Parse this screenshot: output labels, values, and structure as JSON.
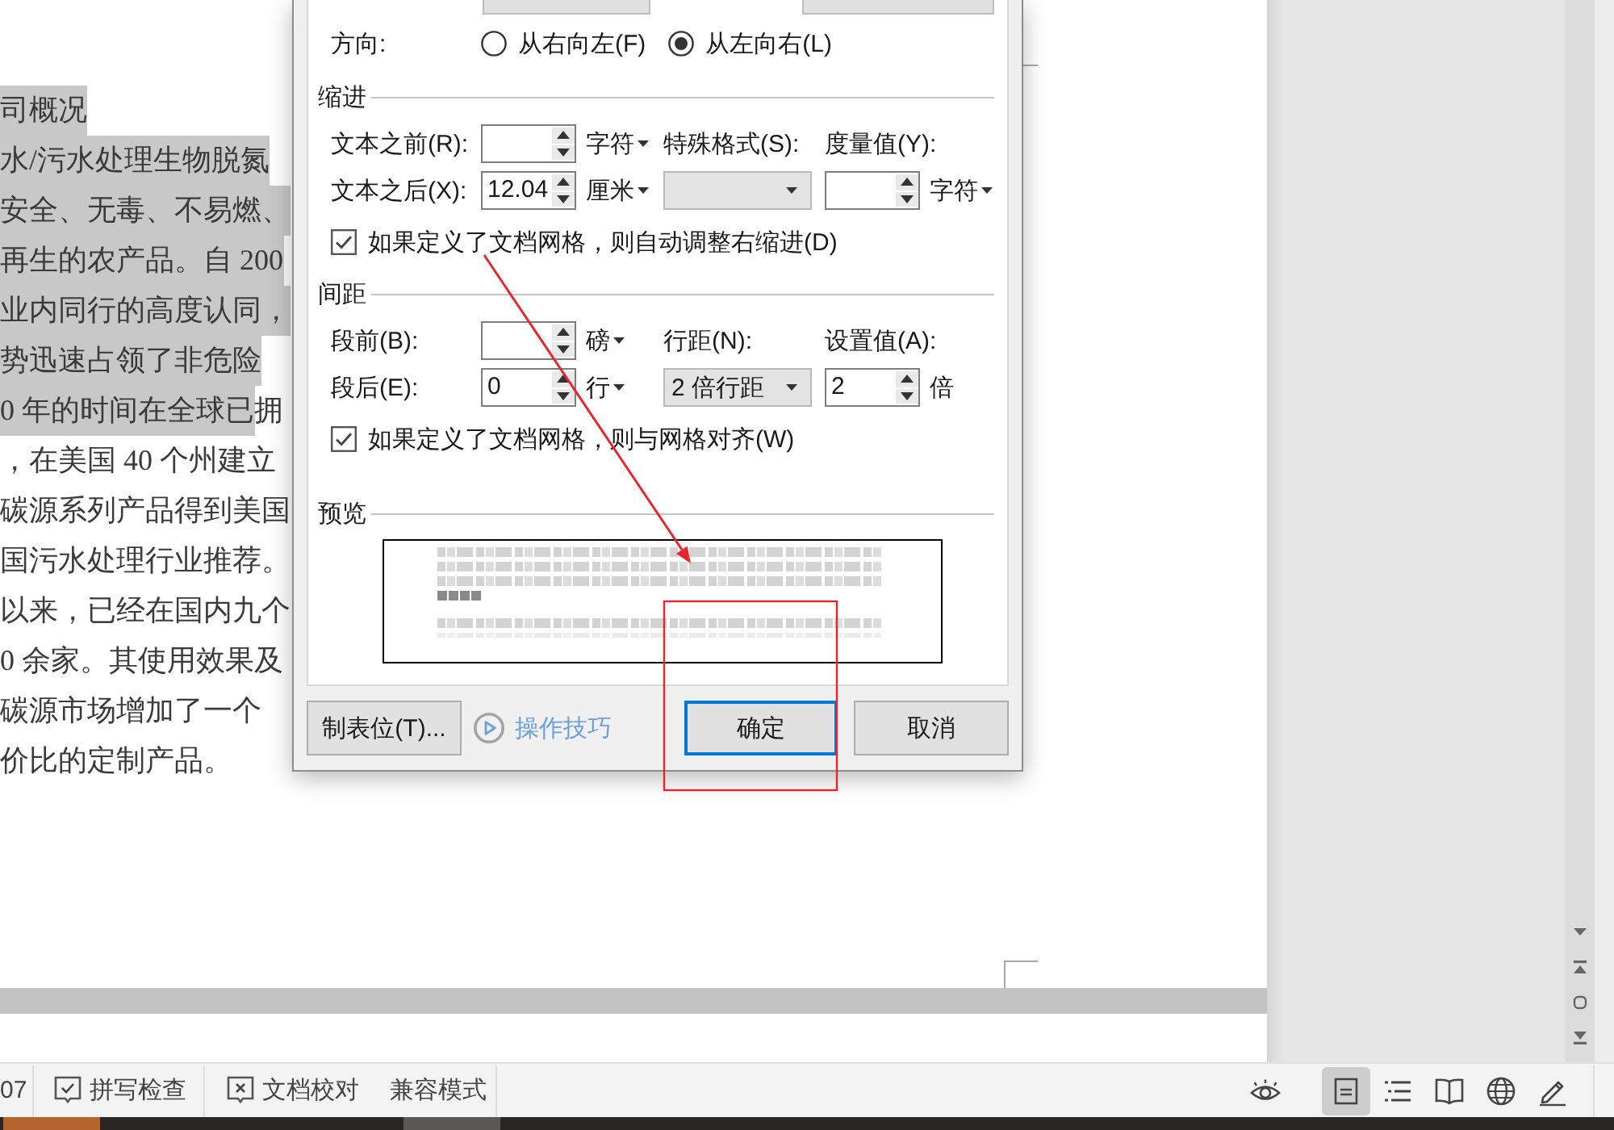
{
  "document": {
    "lines": [
      {
        "segments": [
          {
            "text": "司概况",
            "highlighted": true
          }
        ]
      },
      {
        "segments": [
          {
            "text": "水/污水处理生物脱氮",
            "highlighted": true
          }
        ]
      },
      {
        "segments": [
          {
            "text": "安全、无毒、不易燃、",
            "highlighted": true
          }
        ]
      },
      {
        "segments": [
          {
            "text": "再生的农产品。自 200",
            "highlighted": true
          }
        ]
      },
      {
        "segments": [
          {
            "text": "业内同行的高度认同，",
            "highlighted": true
          }
        ]
      },
      {
        "segments": [
          {
            "text": "势迅速占领了非危险",
            "highlighted": true
          }
        ]
      },
      {
        "segments": [
          {
            "text": "0 年的时间在全球已",
            "highlighted": true
          },
          {
            "text": "拥",
            "highlighted": false
          }
        ]
      },
      {
        "segments": [
          {
            "text": "，在美国 40 个州建立",
            "highlighted": false
          }
        ]
      },
      {
        "segments": [
          {
            "text": "碳源系列产品得到美国",
            "highlighted": false
          }
        ]
      },
      {
        "segments": [
          {
            "text": "国污水处理行业推荐。",
            "highlighted": false
          }
        ]
      },
      {
        "segments": [
          {
            "text": "以来，已经在国内九个",
            "highlighted": false
          }
        ]
      },
      {
        "segments": [
          {
            "text": "0 余家。其使用效果及",
            "highlighted": false
          }
        ]
      },
      {
        "segments": [
          {
            "text": "碳源市场增加了一个",
            "highlighted": false
          }
        ]
      },
      {
        "segments": [
          {
            "text": "价比的定制产品。",
            "highlighted": false
          }
        ]
      }
    ]
  },
  "dialog": {
    "direction": {
      "label": "方向:",
      "options": [
        {
          "label": "从右向左(F)",
          "selected": false
        },
        {
          "label": "从左向右(L)",
          "selected": true
        }
      ]
    },
    "sections": [
      {
        "title": "缩进",
        "rows": [
          [
            {
              "kind": "label",
              "text": "文本之前(R):"
            },
            {
              "kind": "spin"
            },
            {
              "kind": "unit",
              "text": "字符",
              "dropdown": true
            },
            {
              "kind": "label",
              "text": "特殊格式(S):"
            },
            {
              "kind": "label",
              "text": "度量值(Y):"
            }
          ],
          [
            {
              "kind": "label",
              "text": "文本之后(X):"
            },
            {
              "kind": "spin",
              "value": "12.04"
            },
            {
              "kind": "unit",
              "text": "厘米",
              "dropdown": true
            },
            {
              "kind": "select"
            },
            {
              "kind": "spin"
            },
            {
              "kind": "unit",
              "text": "字符",
              "dropdown": true
            }
          ]
        ],
        "checkbox": {
          "label": "如果定义了文档网格，则自动调整右缩进(D)",
          "checked": true
        }
      },
      {
        "title": "间距",
        "rows": [
          [
            {
              "kind": "label",
              "text": "段前(B):"
            },
            {
              "kind": "spin"
            },
            {
              "kind": "unit",
              "text": "磅",
              "dropdown": true
            },
            {
              "kind": "label",
              "text": "行距(N):"
            },
            {
              "kind": "label",
              "text": "设置值(A):"
            }
          ],
          [
            {
              "kind": "label",
              "text": "段后(E):"
            },
            {
              "kind": "spin",
              "value": "0"
            },
            {
              "kind": "unit",
              "text": "行",
              "dropdown": true
            },
            {
              "kind": "select",
              "value": "2 倍行距"
            },
            {
              "kind": "spin",
              "value": "2"
            },
            {
              "kind": "unit",
              "text": "倍",
              "dropdown": false
            }
          ]
        ],
        "checkbox": {
          "label": "如果定义了文档网格，则与网格对齐(W)",
          "checked": true
        }
      }
    ],
    "preview": {
      "title": "预览"
    },
    "buttons": [
      {
        "kind": "button",
        "label": "制表位(T)...",
        "default": false
      },
      {
        "kind": "link",
        "label": "操作技巧"
      },
      {
        "kind": "button",
        "label": "确定",
        "default": true
      },
      {
        "kind": "button",
        "label": "取消",
        "default": false
      }
    ]
  },
  "status_bar": {
    "items": [
      {
        "kind": "text",
        "label": "07"
      },
      {
        "kind": "spellcheck",
        "label": "拼写检查"
      },
      {
        "kind": "proofread",
        "label": "文档校对"
      },
      {
        "kind": "text",
        "label": "兼容模式"
      }
    ],
    "view_buttons": [
      {
        "kind": "eye",
        "selected": false
      },
      {
        "kind": "page",
        "selected": true
      },
      {
        "kind": "outline",
        "selected": false
      },
      {
        "kind": "book",
        "selected": false
      },
      {
        "kind": "globe",
        "selected": false
      },
      {
        "kind": "pen",
        "selected": false
      }
    ]
  },
  "annotations": {
    "arrow": true,
    "box": true
  }
}
